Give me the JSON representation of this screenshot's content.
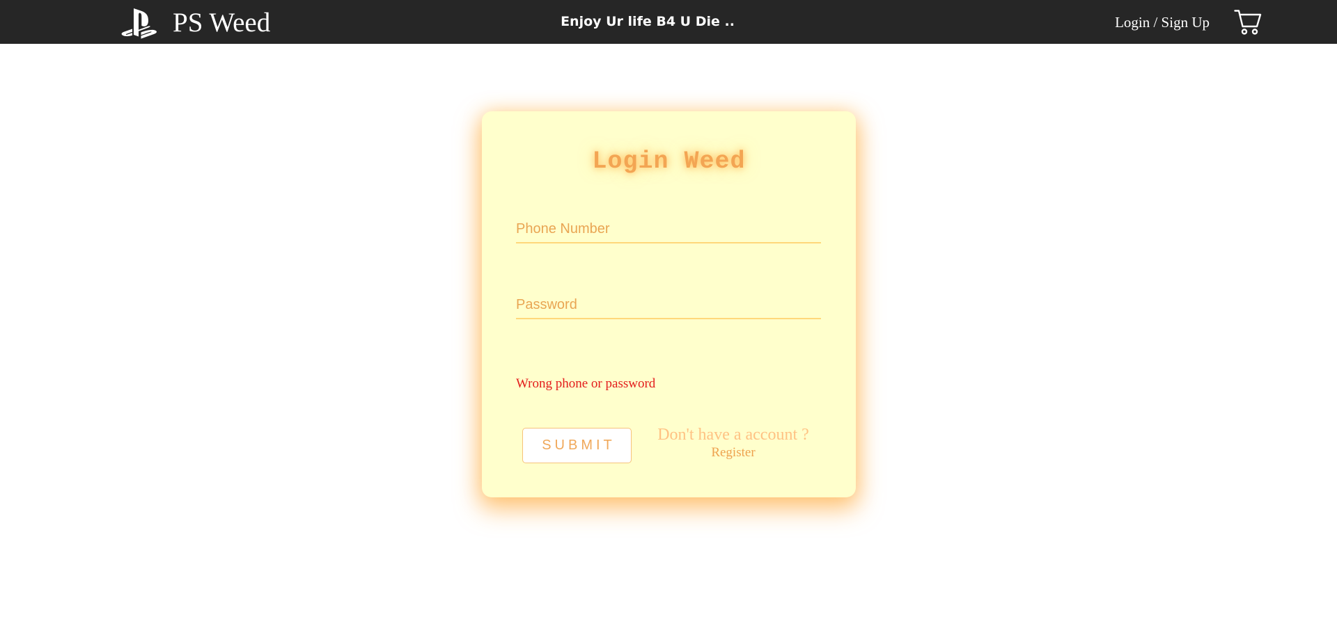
{
  "header": {
    "brand_name": "PS Weed",
    "logo_icon": "playstation-logo-icon",
    "tagline": "Enjoy Ur life B4 U Die ..",
    "auth_link": "Login / Sign Up",
    "cart_icon": "shopping-cart-icon"
  },
  "login_card": {
    "title": "Login Weed",
    "phone_placeholder": "Phone Number",
    "phone_value": "",
    "password_placeholder": "Password",
    "password_value": "",
    "error_message": "Wrong phone or password",
    "submit_label": "SUBMIT",
    "no_account_text": "Don't have a account ?",
    "register_label": "Register"
  },
  "colors": {
    "header_bg": "#262626",
    "card_bg": "#ffffcc",
    "accent_orange": "#f3a553",
    "error_red": "#e31b1b"
  }
}
